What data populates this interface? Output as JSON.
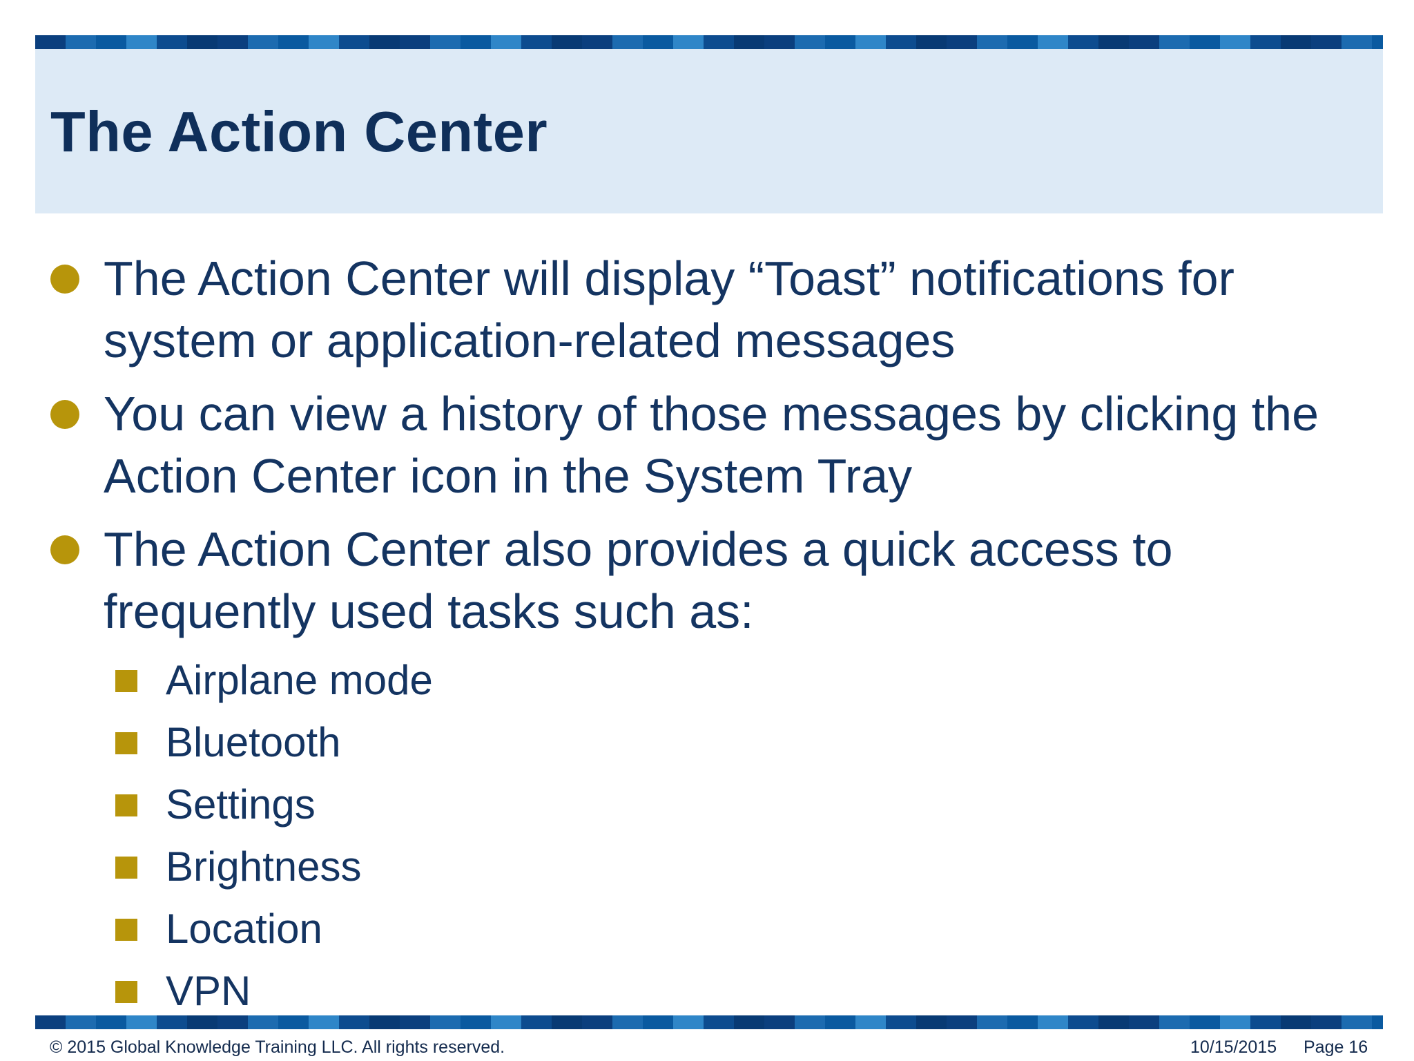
{
  "slide": {
    "title": "The Action Center",
    "bullets": [
      "The Action Center will display “Toast” notifications for system or application-related messages",
      "You can view a history of those messages by clicking the Action Center icon in the System Tray",
      "The Action Center also provides a quick access to frequently used tasks such as:"
    ],
    "sub_items": [
      "Airplane mode",
      "Bluetooth",
      "Settings",
      "Brightness",
      "Location",
      "VPN"
    ]
  },
  "footer": {
    "copyright": "© 2015 Global Knowledge Training LLC. All rights reserved.",
    "date": "10/15/2015",
    "page": "Page 16"
  },
  "colors": {
    "title_text": "#0f2f5a",
    "body_text": "#143461",
    "title_band": "#ddeaf6",
    "bullet_marker": "#b7950b",
    "stripe_dark": "#0b3f7e",
    "stripe_light": "#2f86c8"
  }
}
